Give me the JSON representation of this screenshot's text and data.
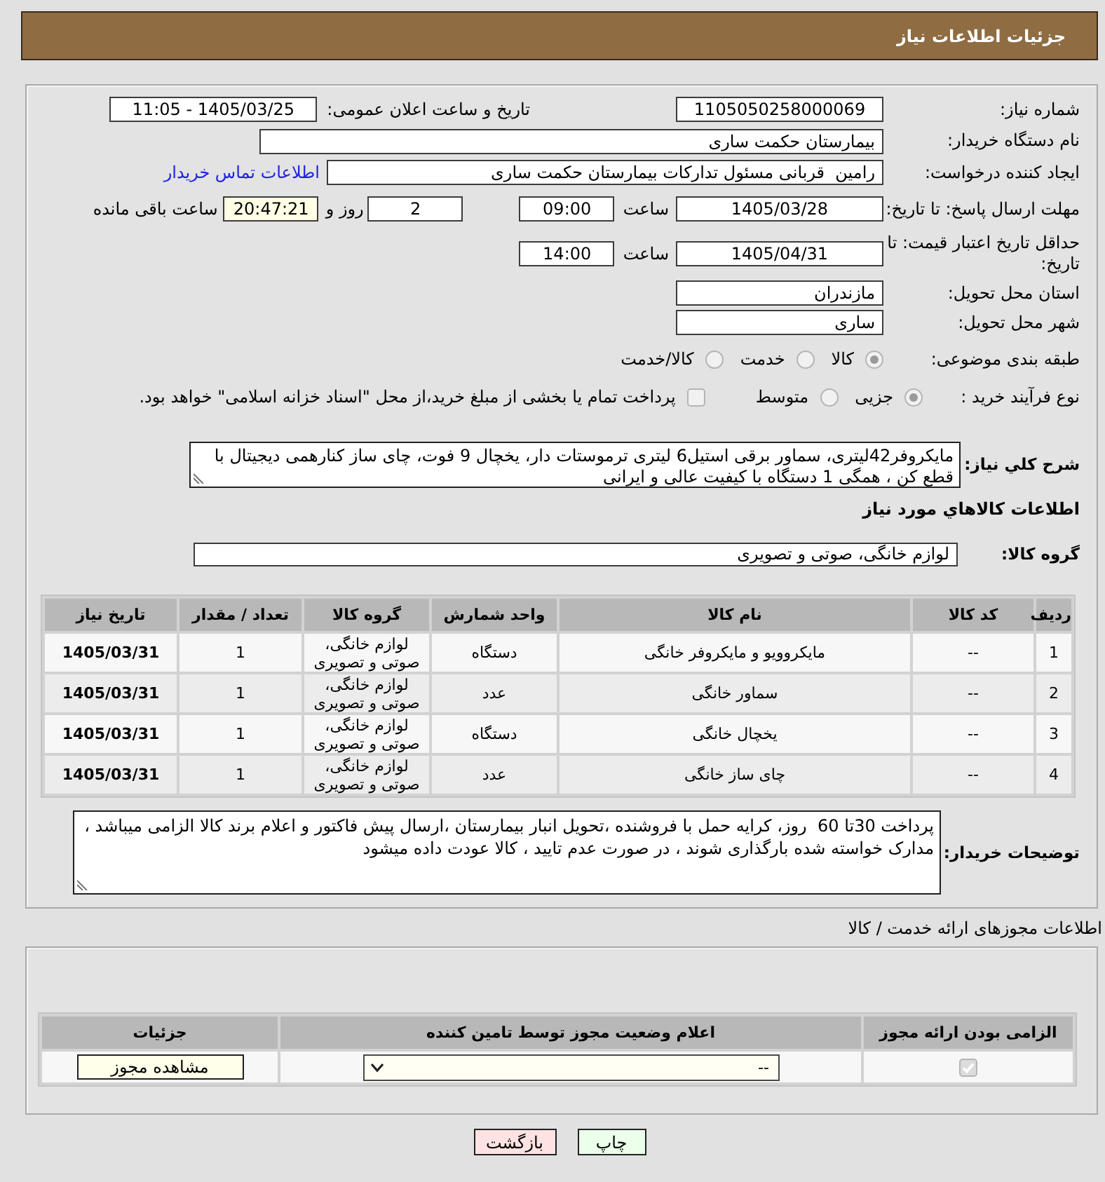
{
  "header": {
    "title": "جزئیات اطلاعات نیاز"
  },
  "details": {
    "need_number": {
      "label": "شماره نیاز:",
      "value": "1105050258000069"
    },
    "announce_date": {
      "label": "تاریخ و ساعت اعلان عمومی:",
      "value": "1405/03/25 - 11:05"
    },
    "buyer_org": {
      "label": "نام دستگاه خریدار:",
      "value": "بیمارستان حکمت ساری"
    },
    "requester": {
      "label": "ایجاد کننده درخواست:",
      "value": "رامین  قربانی مسئول تدارکات بیمارستان حکمت ساری",
      "link": "اطلاعات تماس خریدار"
    },
    "reply_deadline": {
      "label": "مهلت ارسال پاسخ: تا تاریخ:",
      "date": "1405/03/28",
      "time_label": "ساعت",
      "time": "09:00",
      "days": "2",
      "days_label": "روز و",
      "remaining": "20:47:21",
      "remaining_label": "ساعت باقی مانده"
    },
    "price_validity": {
      "label": "حداقل تاریخ اعتبار قیمت: تا تاریخ:",
      "date": "1405/04/31",
      "time_label": "ساعت",
      "time": "14:00"
    },
    "delivery_province": {
      "label": "استان محل تحویل:",
      "value": "مازندران"
    },
    "delivery_city": {
      "label": "شهر محل تحویل:",
      "value": "ساری"
    },
    "category": {
      "label": "طبقه بندی موضوعی:",
      "options": [
        {
          "label": "کالا",
          "selected": true
        },
        {
          "label": "خدمت",
          "selected": false
        },
        {
          "label": "کالا/خدمت",
          "selected": false
        }
      ]
    },
    "purchase_type": {
      "label": "نوع فرآیند خرید :",
      "options": [
        {
          "label": "جزیی",
          "selected": true
        },
        {
          "label": "متوسط",
          "selected": false
        }
      ],
      "treasury": {
        "label": "پرداخت تمام یا بخشی از مبلغ خرید،از محل \"اسناد خزانه اسلامی\" خواهد بود.",
        "checked": false
      }
    }
  },
  "description": {
    "label": "شرح کلي نياز:",
    "value": "مایکروفر42لیتری، سماور برقی استیل6 لیتری ترموستات دار، یخچال 9 فوت، چای ساز کنارهمی دیجیتال با قطع کن ، همگی 1 دستگاه با کیفیت عالی و ایرانی"
  },
  "goods": {
    "title": "اطلاعات کالاهاي مورد نياز",
    "group_label": "گروه کالا:",
    "group_value": "لوازم خانگی، صوتی و تصویری",
    "columns": [
      "ردیف",
      "کد کالا",
      "نام کالا",
      "واحد شمارش",
      "گروه کالا",
      "تعداد / مقدار",
      "تاریخ نیاز"
    ],
    "rows": [
      {
        "row": "1",
        "code": "--",
        "name": "مایکروویو و مایکروفر خانگی",
        "unit": "دستگاه",
        "group": "لوازم خانگی، صوتی و تصویری",
        "quantity": "1",
        "date": "1405/03/31"
      },
      {
        "row": "2",
        "code": "--",
        "name": "سماور خانگی",
        "unit": "عدد",
        "group": "لوازم خانگی، صوتی و تصویری",
        "quantity": "1",
        "date": "1405/03/31"
      },
      {
        "row": "3",
        "code": "--",
        "name": "یخچال خانگی",
        "unit": "دستگاه",
        "group": "لوازم خانگی، صوتی و تصویری",
        "quantity": "1",
        "date": "1405/03/31"
      },
      {
        "row": "4",
        "code": "--",
        "name": "چای ساز خانگی",
        "unit": "عدد",
        "group": "لوازم خانگی، صوتی و تصویری",
        "quantity": "1",
        "date": "1405/03/31"
      }
    ]
  },
  "buyer_notes": {
    "label": "توضیحات خریدار:",
    "value": "پرداخت 30تا 60  روز، کرایه حمل با فروشنده ،تحویل انبار بیمارستان ،ارسال پیش فاکتور و اعلام برند کالا الزامی میباشد ، مدارک خواسته شده بارگذاری شوند ، در صورت عدم تایید ، کالا عودت داده میشود"
  },
  "permits": {
    "title": "اطلاعات مجوزهای ارائه خدمت / کالا",
    "columns": [
      "الزامی بودن ارائه مجوز",
      "اعلام وضعیت مجوز توسط تامین کننده",
      "جزئیات"
    ],
    "rows": [
      {
        "required": true,
        "status": "--",
        "action": "مشاهده مجوز"
      }
    ]
  },
  "buttons": [
    {
      "kind": "print",
      "label": "چاپ"
    },
    {
      "kind": "back",
      "label": "بازگشت"
    }
  ]
}
